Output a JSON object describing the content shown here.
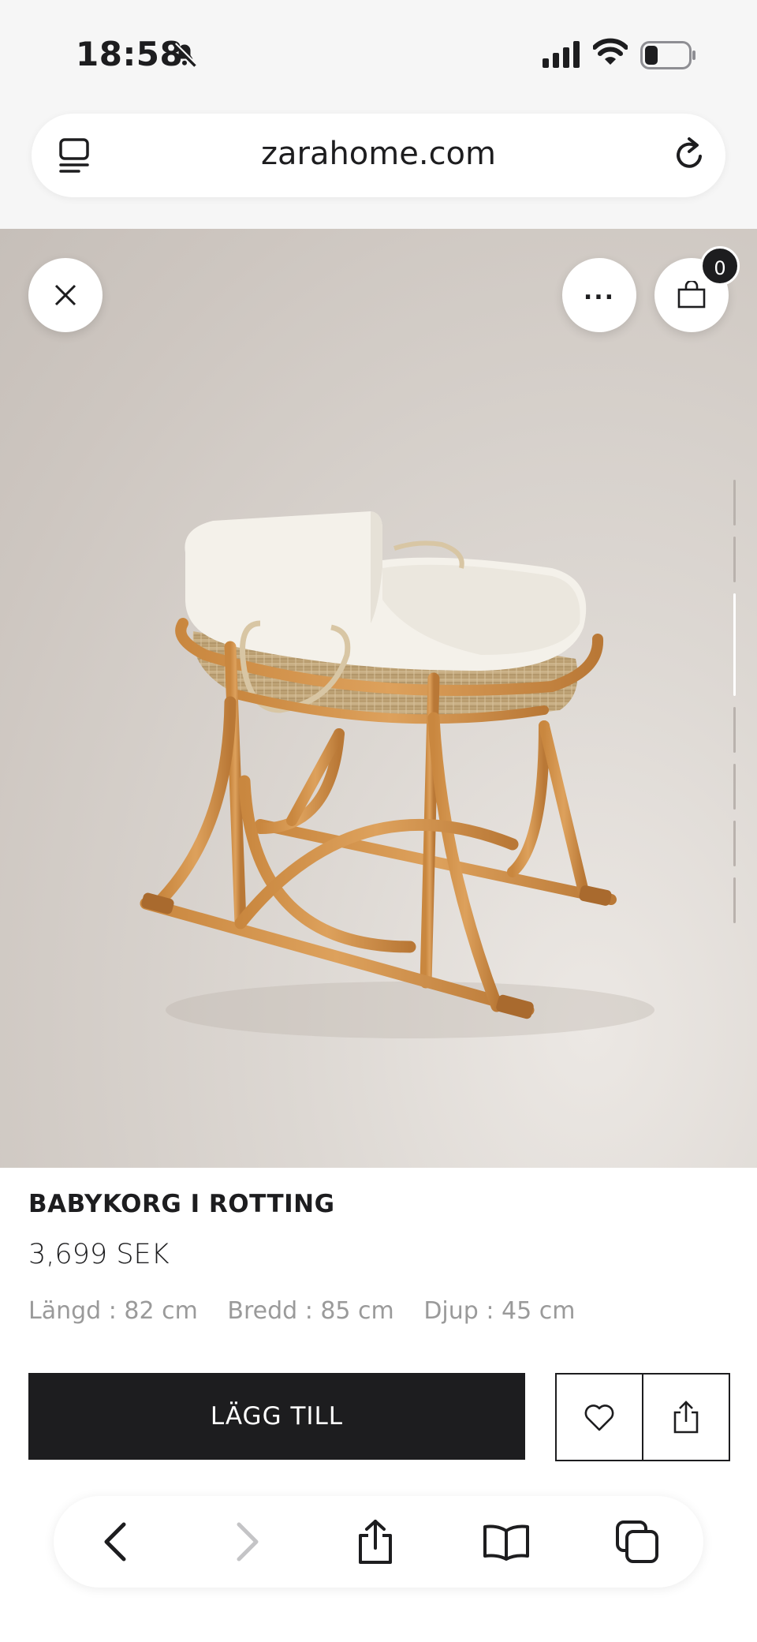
{
  "status_bar": {
    "time": "18:58"
  },
  "browser": {
    "domain": "zarahome.com"
  },
  "product": {
    "title": "BABYKORG I ROTTING",
    "price": "3,699 SEK",
    "dimensions": [
      "Längd : 82 cm",
      "Bredd : 85 cm",
      "Djup : 45 cm"
    ]
  },
  "header_actions": {
    "more_label": "...",
    "cart_count": "0"
  },
  "actions": {
    "add_label": "LÄGG TILL"
  },
  "icons": {
    "status": [
      "bell-slash-icon",
      "cellular-signal-icon",
      "wifi-icon",
      "battery-icon"
    ],
    "url_bar": [
      "reader-mode-icon",
      "reload-icon"
    ],
    "overlay": [
      "close-icon",
      "more-icon",
      "shopping-bag-icon"
    ],
    "product_actions": [
      "heart-icon",
      "share-icon"
    ],
    "toolbar": [
      "back-icon",
      "forward-icon",
      "share-icon",
      "bookmarks-icon",
      "tabs-icon"
    ]
  },
  "colors": {
    "primary": "#1d1d1f",
    "background": "#ffffff",
    "chrome": "#f6f6f6",
    "muted_text": "#9a9a9a"
  }
}
